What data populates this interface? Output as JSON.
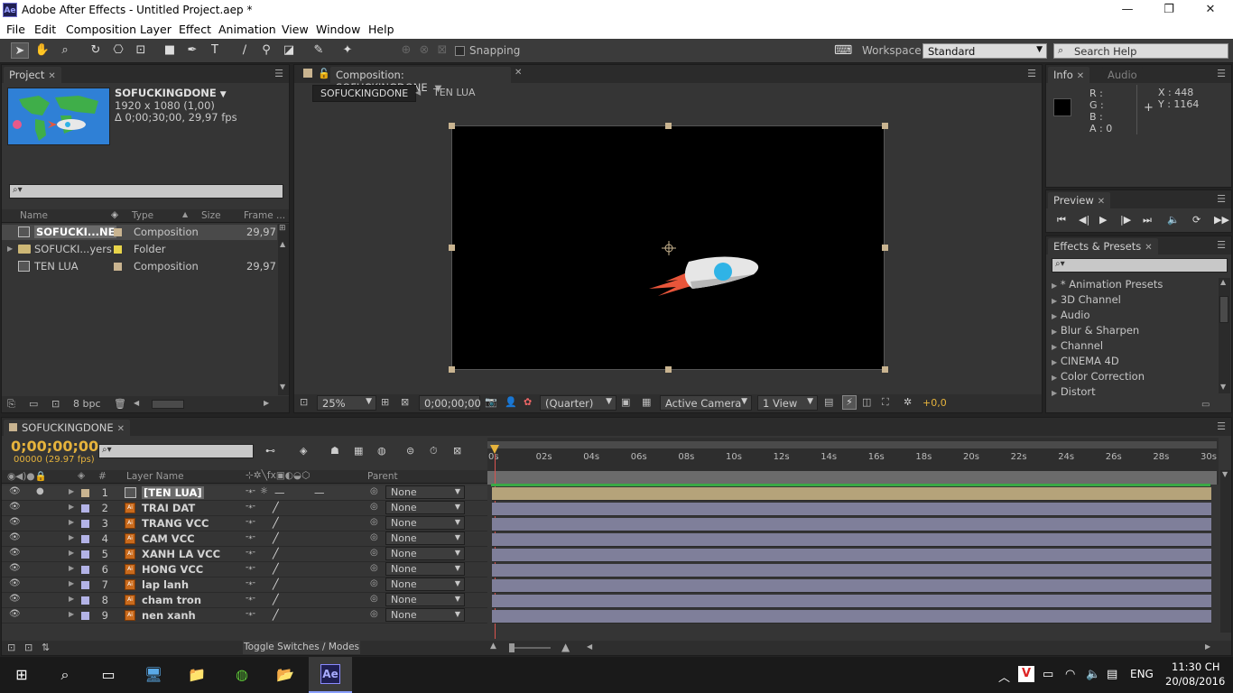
{
  "window": {
    "title": "Adobe After Effects - Untitled Project.aep *",
    "app_badge": "Ae"
  },
  "menu": [
    "File",
    "Edit",
    "Composition",
    "Layer",
    "Effect",
    "Animation",
    "View",
    "Window",
    "Help"
  ],
  "toolbar": {
    "snapping_label": "Snapping",
    "workspace_label": "Workspace:",
    "workspace_value": "Standard",
    "search_placeholder": "Search Help"
  },
  "project_panel": {
    "tab": "Project",
    "comp_name": "SOFUCKINGDONE",
    "comp_size": "1920 x 1080 (1,00)",
    "comp_duration": "Δ 0;00;30;00, 29,97 fps",
    "columns": {
      "name": "Name",
      "type": "Type",
      "size": "Size",
      "frame": "Frame ..."
    },
    "items": [
      {
        "name": "SOFUCKI...NE",
        "type": "Composition",
        "frame": "29,97",
        "color": "#c9b490"
      },
      {
        "name": "SOFUCKI...yers",
        "type": "Folder",
        "frame": "",
        "color": "#e8d44a"
      },
      {
        "name": "TEN LUA",
        "type": "Composition",
        "frame": "29,97",
        "color": "#c9b490"
      }
    ],
    "bpc": "8 bpc"
  },
  "comp_panel": {
    "tab": "Composition: SOFUCKINGDONE",
    "breadcrumb_active": "SOFUCKINGDONE",
    "breadcrumb_next": "TEN LUA",
    "zoom": "25%",
    "timecode": "0;00;00;00",
    "resolution": "(Quarter)",
    "camera": "Active Camera",
    "views": "1 View",
    "exposure": "+0,0"
  },
  "info_panel": {
    "tab_info": "Info",
    "tab_audio": "Audio",
    "r": "R :",
    "g": "G :",
    "b": "B :",
    "a": "A : 0",
    "x": "X : 448",
    "y": "Y : 1164"
  },
  "preview_panel": {
    "tab": "Preview"
  },
  "effects_panel": {
    "tab": "Effects & Presets",
    "items": [
      "* Animation Presets",
      "3D Channel",
      "Audio",
      "Blur & Sharpen",
      "Channel",
      "CINEMA 4D",
      "Color Correction",
      "Distort"
    ]
  },
  "timeline": {
    "tab": "SOFUCKINGDONE",
    "timecode": "0;00;00;00",
    "frames": "00000 (29.97 fps)",
    "col_num": "#",
    "col_layer": "Layer Name",
    "col_parent": "Parent",
    "ruler": [
      "0s",
      "02s",
      "04s",
      "06s",
      "08s",
      "10s",
      "12s",
      "14s",
      "16s",
      "18s",
      "20s",
      "22s",
      "24s",
      "26s",
      "28s",
      "30s"
    ],
    "layers": [
      {
        "num": "1",
        "name": "[TEN LUA]",
        "parent": "None"
      },
      {
        "num": "2",
        "name": "TRAI DAT",
        "parent": "None"
      },
      {
        "num": "3",
        "name": "TRANG VCC",
        "parent": "None"
      },
      {
        "num": "4",
        "name": "CAM VCC",
        "parent": "None"
      },
      {
        "num": "5",
        "name": "XANH LA VCC",
        "parent": "None"
      },
      {
        "num": "6",
        "name": "HONG VCC",
        "parent": "None"
      },
      {
        "num": "7",
        "name": "lap lanh",
        "parent": "None"
      },
      {
        "num": "8",
        "name": "cham tron",
        "parent": "None"
      },
      {
        "num": "9",
        "name": "nen xanh",
        "parent": "None"
      }
    ],
    "toggle_label": "Toggle Switches / Modes"
  },
  "taskbar": {
    "lang": "ENG",
    "time": "11:30 CH",
    "date": "20/08/2016",
    "ae_badge": "Ae"
  },
  "colors": {
    "accent": "#e6b33c",
    "comp_bg": "#000000",
    "rocket_window": "#2fb3e6",
    "flame": "#e8553a",
    "layer_bar": "#7f7f9a",
    "precomp_bar": "#b5a37a",
    "workarea": "#3aa845"
  }
}
